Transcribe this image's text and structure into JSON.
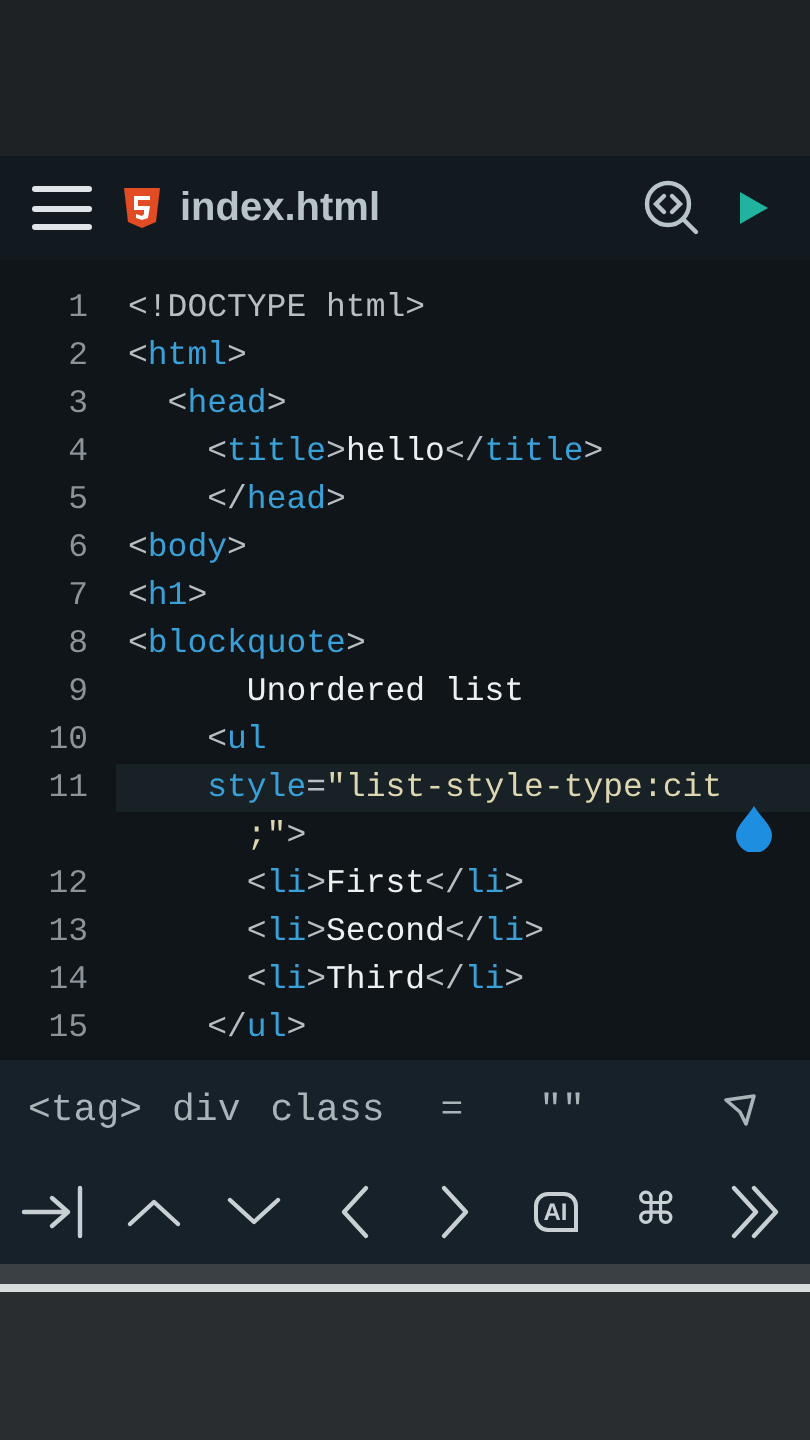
{
  "header": {
    "title": "index.html"
  },
  "lines": [
    {
      "number": "1",
      "highlighted": false,
      "tokens": [
        {
          "kind": "punct",
          "text": "<!DOCTYPE html>"
        }
      ]
    },
    {
      "number": "2",
      "highlighted": false,
      "tokens": [
        {
          "kind": "punct",
          "text": "<"
        },
        {
          "kind": "tag",
          "text": "html"
        },
        {
          "kind": "punct",
          "text": ">"
        }
      ]
    },
    {
      "number": "3",
      "highlighted": false,
      "tokens": [
        {
          "kind": "punct",
          "text": "  <"
        },
        {
          "kind": "tag",
          "text": "head"
        },
        {
          "kind": "punct",
          "text": ">"
        }
      ]
    },
    {
      "number": "4",
      "highlighted": false,
      "tokens": [
        {
          "kind": "punct",
          "text": "    <"
        },
        {
          "kind": "tag",
          "text": "title"
        },
        {
          "kind": "punct",
          "text": ">"
        },
        {
          "kind": "text",
          "text": "hello"
        },
        {
          "kind": "punct",
          "text": "</"
        },
        {
          "kind": "tag",
          "text": "title"
        },
        {
          "kind": "punct",
          "text": ">"
        }
      ]
    },
    {
      "number": "5",
      "highlighted": false,
      "tokens": [
        {
          "kind": "punct",
          "text": "    </"
        },
        {
          "kind": "tag",
          "text": "head"
        },
        {
          "kind": "punct",
          "text": ">"
        }
      ]
    },
    {
      "number": "6",
      "highlighted": false,
      "tokens": [
        {
          "kind": "punct",
          "text": "<"
        },
        {
          "kind": "tag",
          "text": "body"
        },
        {
          "kind": "punct",
          "text": ">"
        }
      ]
    },
    {
      "number": "7",
      "highlighted": false,
      "tokens": [
        {
          "kind": "punct",
          "text": "<"
        },
        {
          "kind": "tag",
          "text": "h1"
        },
        {
          "kind": "punct",
          "text": ">"
        }
      ]
    },
    {
      "number": "8",
      "highlighted": false,
      "tokens": [
        {
          "kind": "punct",
          "text": "<"
        },
        {
          "kind": "tag",
          "text": "blockquote"
        },
        {
          "kind": "punct",
          "text": ">"
        }
      ]
    },
    {
      "number": "9",
      "highlighted": false,
      "tokens": [
        {
          "kind": "text",
          "text": "      Unordered list"
        }
      ]
    },
    {
      "number": "10",
      "highlighted": false,
      "tokens": [
        {
          "kind": "punct",
          "text": "    <"
        },
        {
          "kind": "tag",
          "text": "ul"
        }
      ]
    },
    {
      "number": "11",
      "highlighted": true,
      "tokens": [
        {
          "kind": "tag",
          "text": "    style"
        },
        {
          "kind": "punct",
          "text": "="
        },
        {
          "kind": "string",
          "text": "\"list-style-type:cit"
        }
      ]
    },
    {
      "highlighted": false,
      "tokens": [
        {
          "kind": "string",
          "text": "      ;\""
        },
        {
          "kind": "punct",
          "text": ">"
        }
      ]
    },
    {
      "number": "12",
      "highlighted": false,
      "tokens": [
        {
          "kind": "punct",
          "text": "      <"
        },
        {
          "kind": "tag",
          "text": "li"
        },
        {
          "kind": "punct",
          "text": ">"
        },
        {
          "kind": "text",
          "text": "First"
        },
        {
          "kind": "punct",
          "text": "</"
        },
        {
          "kind": "tag",
          "text": "li"
        },
        {
          "kind": "punct",
          "text": ">"
        }
      ]
    },
    {
      "number": "13",
      "highlighted": false,
      "tokens": [
        {
          "kind": "punct",
          "text": "      <"
        },
        {
          "kind": "tag",
          "text": "li"
        },
        {
          "kind": "punct",
          "text": ">"
        },
        {
          "kind": "text",
          "text": "Second"
        },
        {
          "kind": "punct",
          "text": "</"
        },
        {
          "kind": "tag",
          "text": "li"
        },
        {
          "kind": "punct",
          "text": ">"
        }
      ]
    },
    {
      "number": "14",
      "highlighted": false,
      "tokens": [
        {
          "kind": "punct",
          "text": "      <"
        },
        {
          "kind": "tag",
          "text": "li"
        },
        {
          "kind": "punct",
          "text": ">"
        },
        {
          "kind": "text",
          "text": "Third"
        },
        {
          "kind": "punct",
          "text": "</"
        },
        {
          "kind": "tag",
          "text": "li"
        },
        {
          "kind": "punct",
          "text": ">"
        }
      ]
    },
    {
      "number": "15",
      "highlighted": false,
      "tokens": [
        {
          "kind": "punct",
          "text": "    </"
        },
        {
          "kind": "tag",
          "text": "ul"
        },
        {
          "kind": "punct",
          "text": ">"
        }
      ]
    }
  ],
  "snippets": [
    "<tag>",
    "div",
    "class",
    "=",
    "\"\""
  ],
  "keys": [
    {
      "kind": "tab"
    },
    {
      "kind": "up"
    },
    {
      "kind": "down"
    },
    {
      "kind": "left"
    },
    {
      "kind": "right"
    },
    {
      "kind": "ai",
      "label": "AI"
    },
    {
      "kind": "command",
      "label": "⌘"
    },
    {
      "kind": "more"
    }
  ]
}
